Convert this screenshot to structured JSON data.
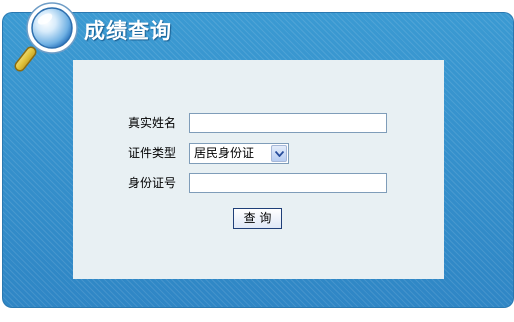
{
  "header": {
    "title": "成绩查询",
    "icon": "magnifier-icon"
  },
  "form": {
    "name_label": "真实姓名",
    "name_value": "",
    "id_type_label": "证件类型",
    "id_type_selected": "居民身份证",
    "id_number_label": "身份证号",
    "id_number_value": "",
    "submit_label": "查 询"
  },
  "colors": {
    "panel_blue": "#3b9ad2",
    "content_bg": "#e8f0f3",
    "input_border": "#7f9db9"
  }
}
